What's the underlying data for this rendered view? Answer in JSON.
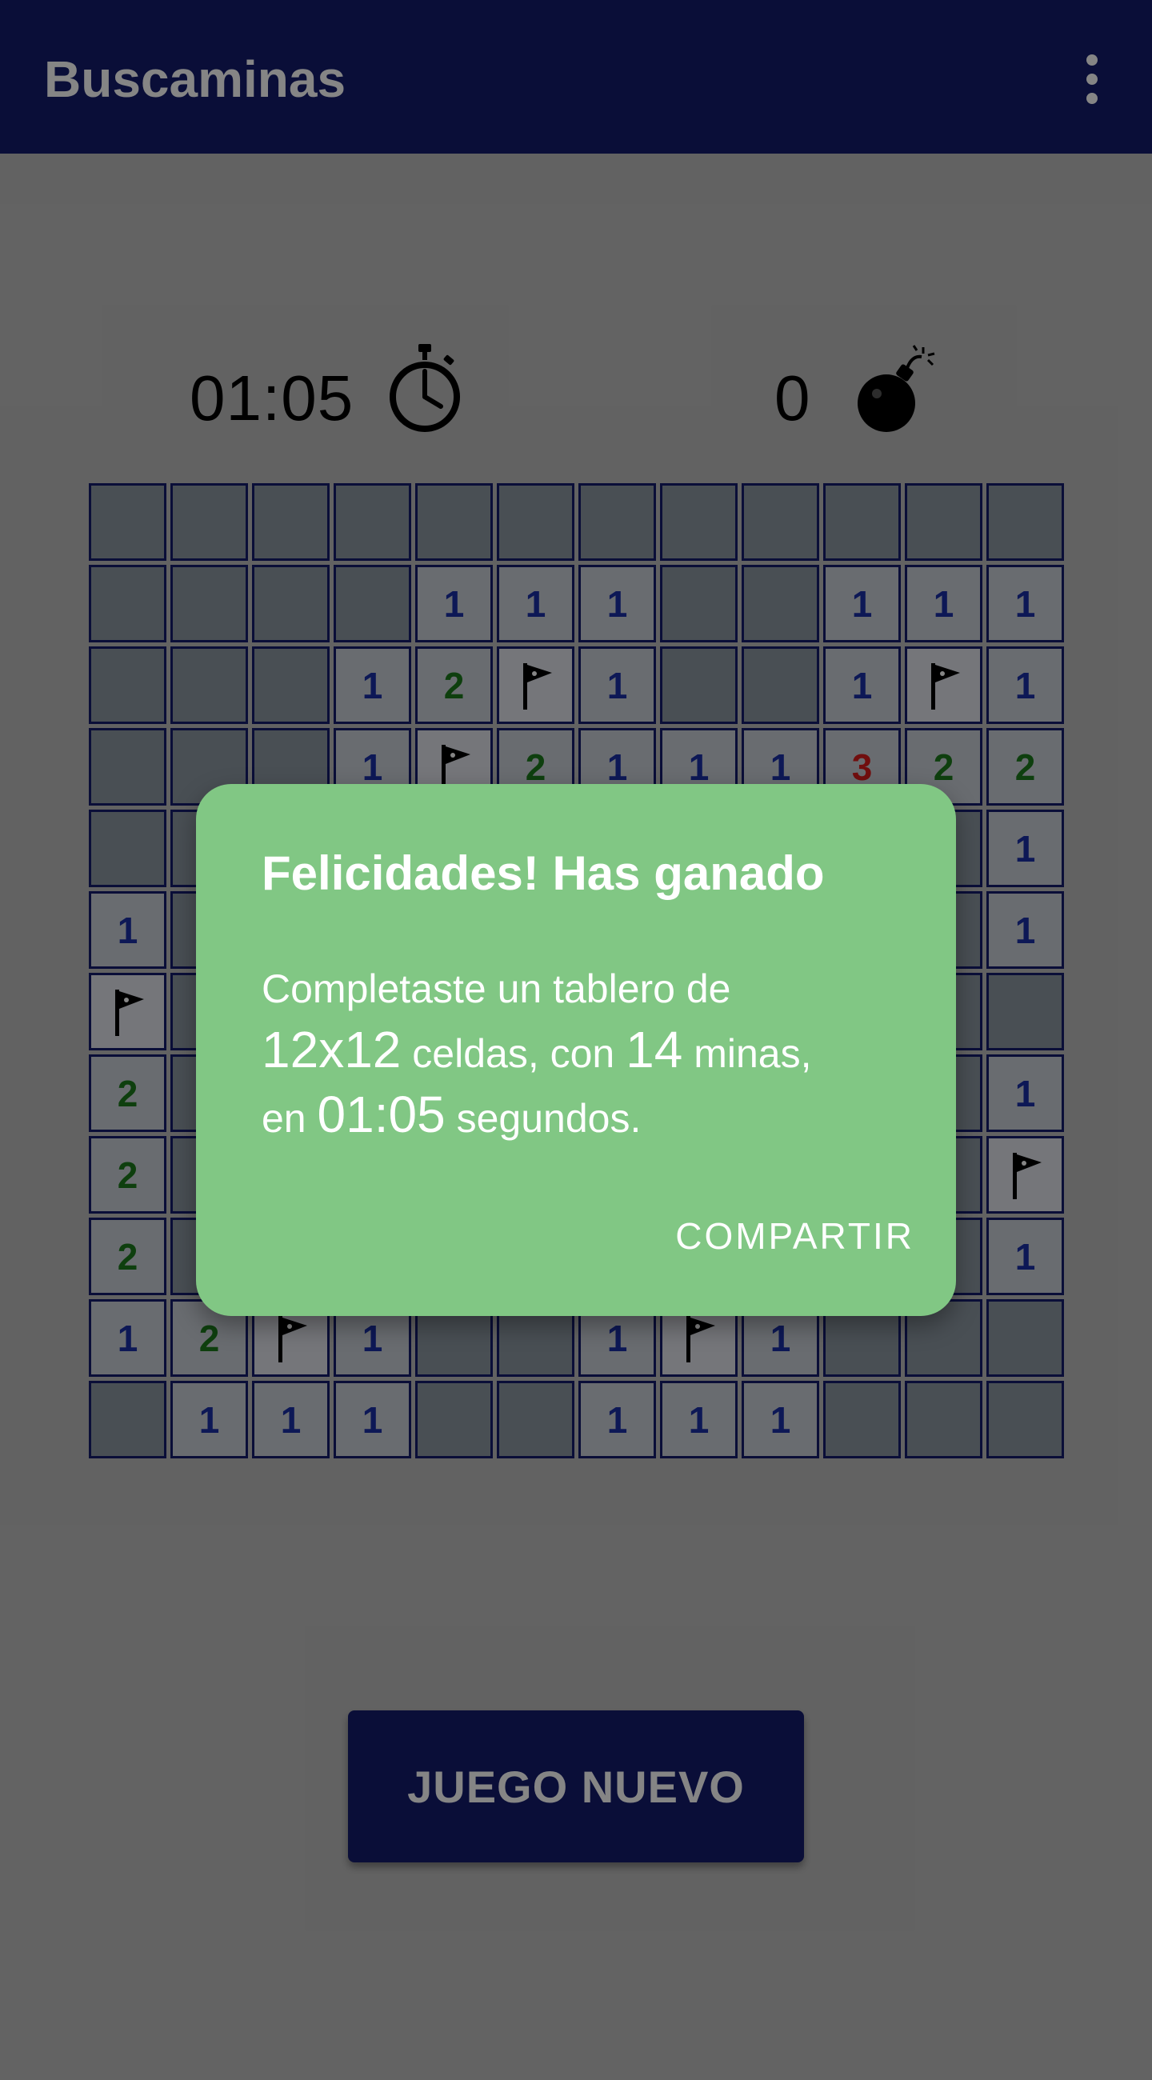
{
  "app": {
    "title": "Buscaminas",
    "menu_icon": "more-vert-icon"
  },
  "status": {
    "timer": "01:05",
    "timer_icon": "stopwatch-icon",
    "mines_remaining": "0",
    "mines_icon": "bomb-icon"
  },
  "board": {
    "rows": [
      [
        "H",
        "H",
        "H",
        "H",
        "H",
        "H",
        "H",
        "H",
        "H",
        "H",
        "H",
        "H"
      ],
      [
        "H",
        "H",
        "H",
        "H",
        "1",
        "1",
        "1",
        "H",
        "H",
        "1",
        "1",
        "1"
      ],
      [
        "H",
        "H",
        "H",
        "1",
        "2",
        "F",
        "1",
        "H",
        "H",
        "1",
        "F",
        "1"
      ],
      [
        "H",
        "H",
        "H",
        "1",
        "F",
        "2",
        "1",
        "1",
        "1",
        "3",
        "2",
        "2"
      ],
      [
        "H",
        "H",
        "H",
        "H",
        "H",
        "H",
        "H",
        "H",
        "H",
        "H",
        "H",
        "1"
      ],
      [
        "1",
        "H",
        "H",
        "H",
        "H",
        "H",
        "H",
        "H",
        "H",
        "H",
        "H",
        "1"
      ],
      [
        "F",
        "H",
        "H",
        "H",
        "H",
        "H",
        "H",
        "H",
        "H",
        "H",
        "H",
        "H"
      ],
      [
        "2",
        "H",
        "H",
        "H",
        "H",
        "H",
        "H",
        "H",
        "H",
        "H",
        "H",
        "1"
      ],
      [
        "2",
        "H",
        "H",
        "H",
        "H",
        "H",
        "H",
        "H",
        "H",
        "H",
        "H",
        "F"
      ],
      [
        "2",
        "H",
        "H",
        "H",
        "H",
        "H",
        "H",
        "H",
        "H",
        "H",
        "H",
        "1"
      ],
      [
        "1",
        "2",
        "F",
        "1",
        "H",
        "H",
        "1",
        "F",
        "1",
        "H",
        "H",
        "H"
      ],
      [
        "H",
        "1",
        "1",
        "1",
        "H",
        "H",
        "1",
        "1",
        "1",
        "H",
        "H",
        "H"
      ]
    ]
  },
  "new_game_label": "JUEGO NUEVO",
  "dialog": {
    "title": "Felicidades! Has ganado",
    "line1": "Completaste un tablero de",
    "size": "12x12",
    "mid1": "celdas, con",
    "mines": "14",
    "mid2": "minas,",
    "pre_time": "en",
    "time": "01:05",
    "post_time": "segundos.",
    "share_label": "COMPARTIR"
  },
  "colors": {
    "app_bar": "#141b6b",
    "dialog_bg": "#81c784",
    "cell_hidden": "#8c97a1",
    "cell_flag": "#e0e3ea",
    "num1": "#1a2ea6",
    "num2": "#1b7a1b",
    "num3": "#d81b1b"
  }
}
